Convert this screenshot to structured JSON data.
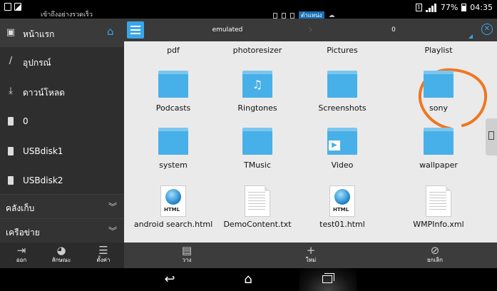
{
  "status_bar": {
    "marquee_text": "เข้าถึงอย่างรวดเร็ว",
    "storage_chip": "ตำแหน่ง",
    "battery": "77%",
    "time": "04:35",
    "sim_label": "1"
  },
  "sidebar": {
    "home_label": "หน้าแรก",
    "items": [
      {
        "label": "อุปกรณ์",
        "icon": "slash-icon"
      },
      {
        "label": "ดาวน์โหลด",
        "icon": "download-icon"
      },
      {
        "label": "0",
        "icon": "sdcard-icon"
      },
      {
        "label": "USBdisk1",
        "icon": "sdcard-icon"
      },
      {
        "label": "USBdisk2",
        "icon": "sdcard-icon"
      }
    ],
    "sections": [
      {
        "label": "คลังเก็บ"
      },
      {
        "label": "เครือข่าย"
      }
    ]
  },
  "path": {
    "crumbs": [
      "emulated",
      "0"
    ]
  },
  "files": [
    {
      "name": "pdf",
      "kind": "folder-partial"
    },
    {
      "name": "photoresizer",
      "kind": "folder-partial"
    },
    {
      "name": "Pictures",
      "kind": "folder-partial"
    },
    {
      "name": "Playlist",
      "kind": "folder-partial"
    },
    {
      "name": "Podcasts",
      "kind": "folder"
    },
    {
      "name": "Ringtones",
      "kind": "folder-music"
    },
    {
      "name": "Screenshots",
      "kind": "folder"
    },
    {
      "name": "sony",
      "kind": "folder"
    },
    {
      "name": "system",
      "kind": "folder"
    },
    {
      "name": "TMusic",
      "kind": "folder"
    },
    {
      "name": "Video",
      "kind": "folder-video"
    },
    {
      "name": "wallpaper",
      "kind": "folder"
    },
    {
      "name": "android search.html",
      "kind": "html"
    },
    {
      "name": "DemoContent.txt",
      "kind": "text"
    },
    {
      "name": "test01.html",
      "kind": "html"
    },
    {
      "name": "WMPInfo.xml",
      "kind": "text"
    }
  ],
  "toolbar": {
    "left": [
      {
        "label": "ออก",
        "icon": "exit-icon"
      },
      {
        "label": "ลักษณะ",
        "icon": "theme-icon"
      },
      {
        "label": "ตั้งค่า",
        "icon": "settings-icon"
      }
    ],
    "right": [
      {
        "label": "วาง",
        "icon": "paste-icon"
      },
      {
        "label": "ใหม่",
        "icon": "plus-icon"
      },
      {
        "label": "ยกเลิก",
        "icon": "cancel-icon"
      }
    ]
  },
  "html_tag": "HTML",
  "annotation_color": "#ee7722"
}
